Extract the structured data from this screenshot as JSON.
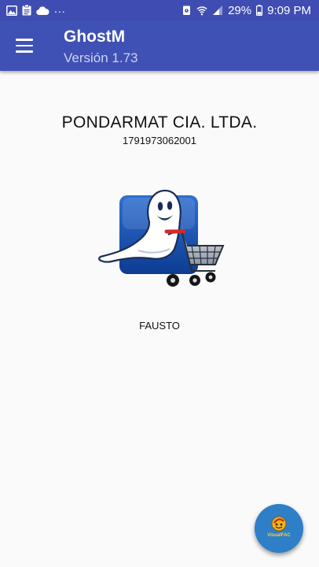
{
  "status_bar": {
    "icons_left": [
      "image-icon",
      "clipboard-icon",
      "cloud-icon"
    ],
    "overflow": "...",
    "icons_right": [
      "alarm-icon",
      "wifi-icon",
      "signal-icon",
      "battery-icon"
    ],
    "battery_percent": "29%",
    "time": "9:09 PM"
  },
  "app_bar": {
    "menu_icon": "hamburger-menu-icon",
    "title": "GhostM",
    "subtitle": "Versión 1.73",
    "color": "#3f51b5"
  },
  "company": {
    "name": "PONDARMAT CIA. LTDA.",
    "ruc": "1791973062001"
  },
  "logo": {
    "icon": "ghost-shopping-cart-logo"
  },
  "user": {
    "name": "FAUSTO"
  },
  "fab": {
    "icon": "visualfac-logo-icon",
    "label": "VisualFAC",
    "color": "#2e7fc7"
  }
}
